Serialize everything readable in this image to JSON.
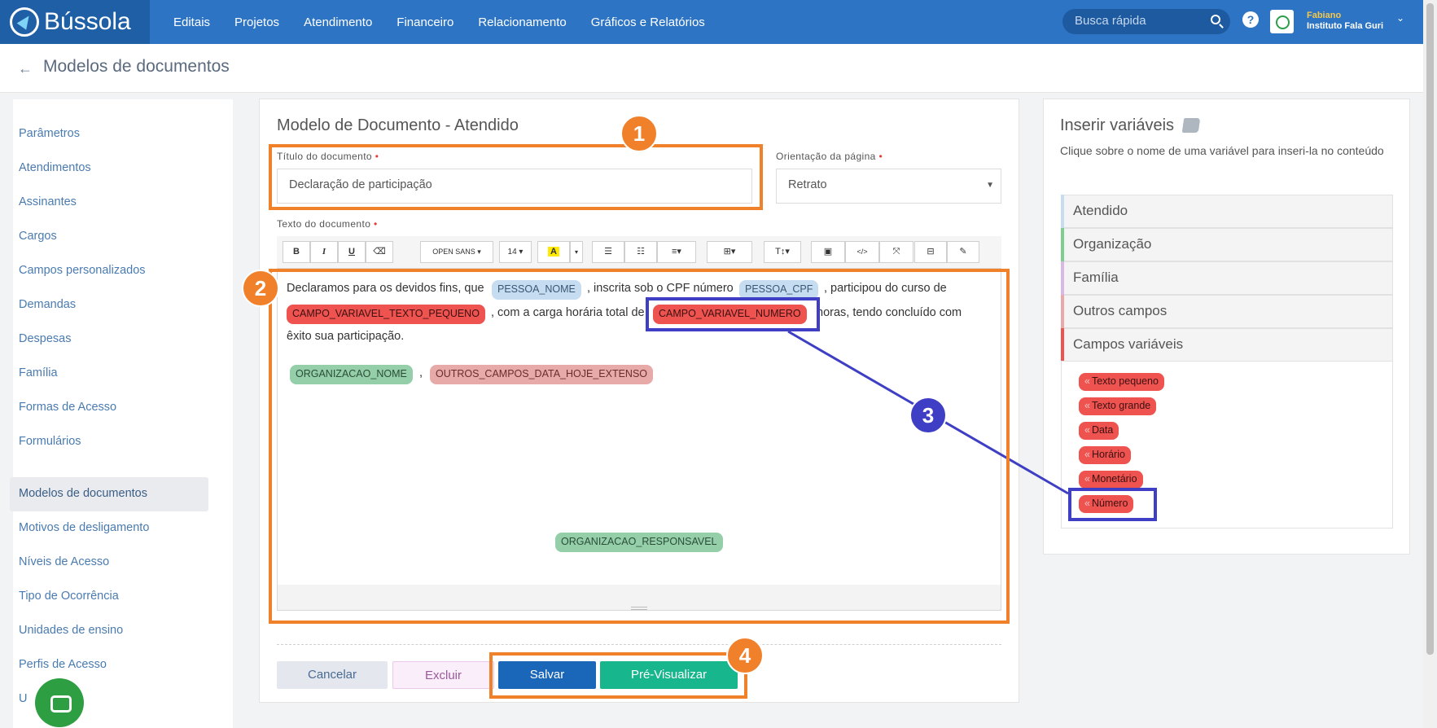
{
  "app": {
    "brand": "Bússola"
  },
  "nav": [
    "Editais",
    "Projetos",
    "Atendimento",
    "Financeiro",
    "Relacionamento",
    "Gráficos e Relatórios"
  ],
  "search": {
    "placeholder": "Busca rápida"
  },
  "user": {
    "name": "Fabiano",
    "org": "Instituto Fala Guri"
  },
  "page": {
    "title": "Modelos de documentos"
  },
  "sidebar": {
    "items": [
      "Parâmetros",
      "Atendimentos",
      "Assinantes",
      "Cargos",
      "Campos personalizados",
      "Demandas",
      "Despesas",
      "Família",
      "Formas de Acesso",
      "Formulários",
      "Modelos de documentos",
      "Motivos de desligamento",
      "Níveis de Acesso",
      "Tipo de Ocorrência",
      "Unidades de ensino",
      "Perfis de Acesso",
      "U"
    ],
    "active": "Modelos de documentos"
  },
  "form": {
    "heading": "Modelo de Documento - Atendido",
    "title_label": "Título do documento",
    "title_value": "Declaração de participação",
    "orientation_label": "Orientação da página",
    "orientation_value": "Retrato",
    "text_label": "Texto do documento",
    "required_mark": "•"
  },
  "toolbar": {
    "bold": "B",
    "italic": "I",
    "underline": "U",
    "eraser": "⌫",
    "font": "OPEN SANS ▾",
    "size": "14 ▾",
    "highlight": "A",
    "code": "</>",
    "caret": "▾"
  },
  "doc": {
    "t1": "Declaramos para os devidos fins, que",
    "v_pessoa_nome": "PESSOA_NOME",
    "t2": ", inscrita sob o CPF número",
    "v_pessoa_cpf": "PESSOA_CPF",
    "t3": ", participou do curso de",
    "v_texto_pequeno": "CAMPO_VARIAVEL_TEXTO_PEQUENO",
    "t4": ", com a carga horária total de",
    "v_numero": "CAMPO_VARIAVEL_NUMERO",
    "t5": "horas, tendo concluído com",
    "t6": "êxito sua participação.",
    "v_org_nome": "ORGANIZACAO_NOME",
    "comma": ",",
    "v_data_hoje": "OUTROS_CAMPOS_DATA_HOJE_EXTENSO",
    "v_org_resp": "ORGANIZACAO_RESPONSAVEL"
  },
  "buttons": {
    "cancel": "Cancelar",
    "delete": "Excluir",
    "save": "Salvar",
    "preview": "Pré-Visualizar"
  },
  "variables_panel": {
    "title": "Inserir variáveis",
    "description": "Clique sobre o nome de uma variável para inseri-la no conteúdo",
    "groups": [
      {
        "label": "Atendido",
        "color": "#c6dcf0"
      },
      {
        "label": "Organização",
        "color": "#7ccf8f"
      },
      {
        "label": "Família",
        "color": "#d9b8e6"
      },
      {
        "label": "Outros campos",
        "color": "#e8a9a9"
      },
      {
        "label": "Campos variáveis",
        "color": "#ef5350"
      }
    ],
    "quote": "«",
    "campos_variaveis": [
      "Texto pequeno",
      "Texto grande",
      "Data",
      "Horário",
      "Monetário",
      "Número"
    ]
  },
  "annotations": [
    "1",
    "2",
    "3",
    "4"
  ],
  "colors": {
    "primary": "#2d74c4",
    "annotation_orange": "#f0812a",
    "annotation_blue": "#3e3fc4",
    "variable_red": "#ef5350"
  }
}
